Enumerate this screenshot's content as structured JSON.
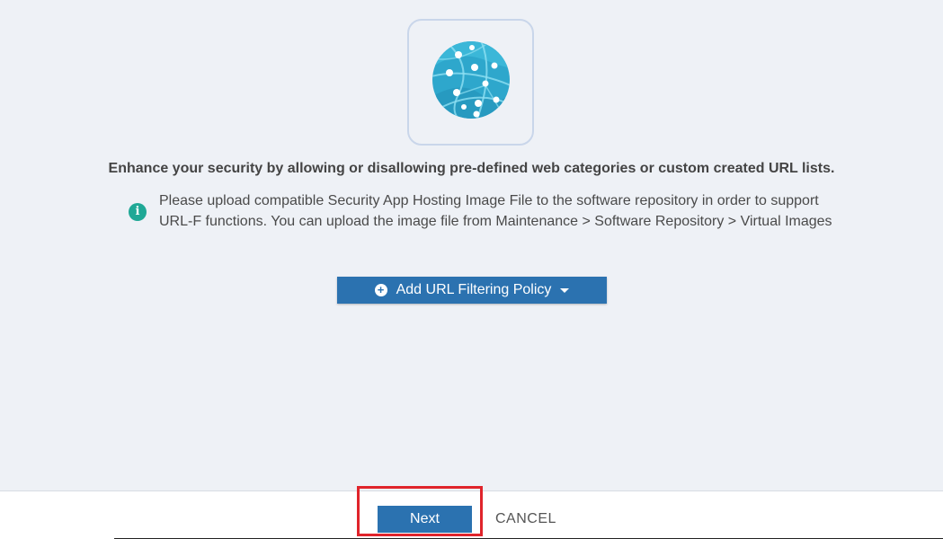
{
  "hero": {
    "icon": "globe-network-icon",
    "colors": {
      "globe": "#2ea7cc",
      "globe_light": "#6fd0e8",
      "card_border": "#c9d6ea"
    }
  },
  "headline": "Enhance your security by allowing or disallowing pre-defined web categories or custom created URL lists.",
  "info": {
    "icon": "info-icon",
    "icon_glyph": "i",
    "icon_color": "#1fa896",
    "message": "Please upload compatible Security App Hosting Image File to the software repository in order to support URL-F functions. You can upload the image file from Maintenance > Software Repository > Virtual Images"
  },
  "add_policy_button": {
    "label": "Add URL Filtering Policy",
    "icon": "plus-circle-icon",
    "dropdown_icon": "caret-down-icon",
    "color": "#2b72b0"
  },
  "footer": {
    "next_label": "Next",
    "cancel_label": "CANCEL",
    "highlight_color": "#e0242b"
  }
}
